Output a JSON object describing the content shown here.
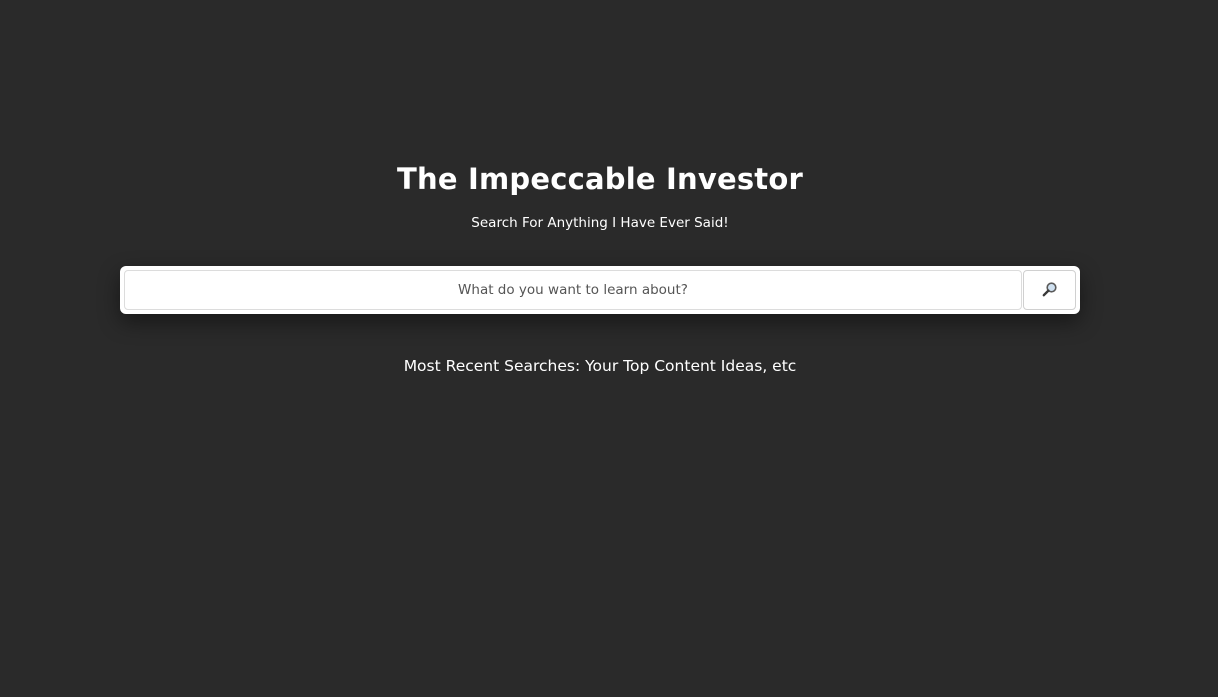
{
  "header": {
    "title": "The Impeccable Investor",
    "subtitle": "Search For Anything I Have Ever Said!"
  },
  "search": {
    "placeholder": "What do you want to learn about?",
    "value": "",
    "button_icon": "search-icon"
  },
  "recent": {
    "text": "Most Recent Searches: Your Top Content Ideas, etc"
  },
  "colors": {
    "background": "#2a2a2a",
    "text": "#ffffff",
    "search_box": "#ffffff",
    "placeholder": "#555555"
  }
}
